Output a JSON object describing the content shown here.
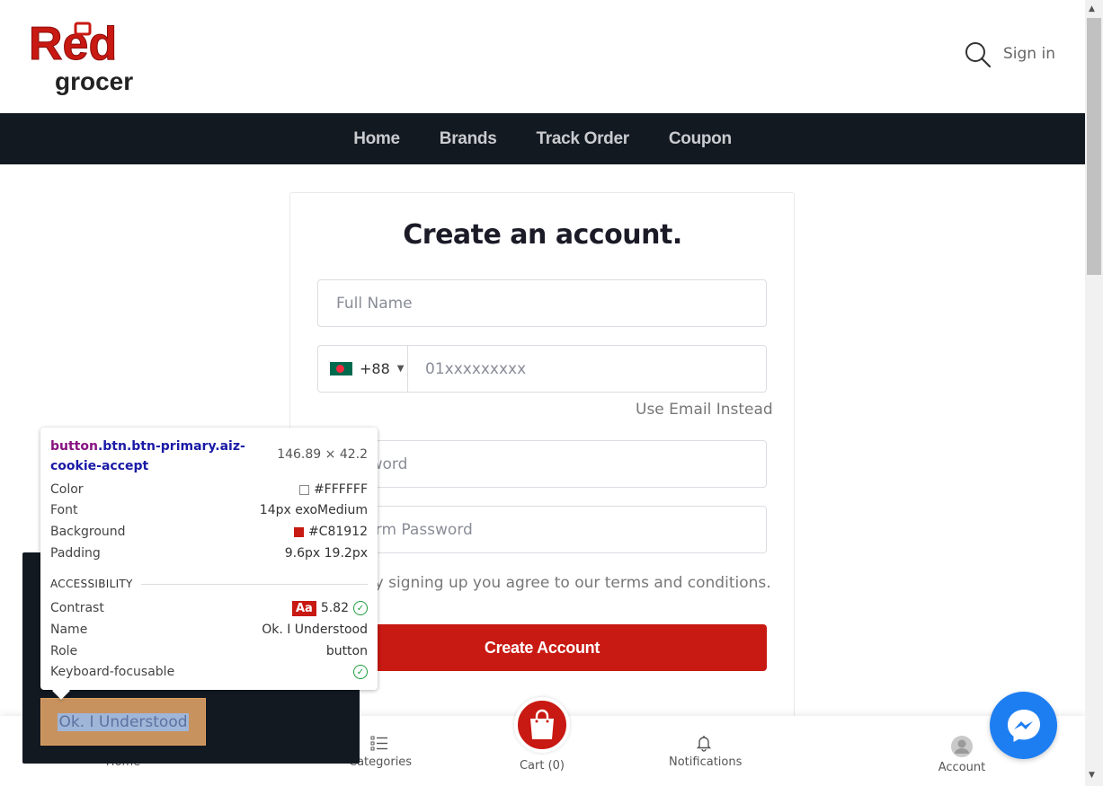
{
  "header": {
    "logo_top": "Red",
    "logo_bottom": "grocer",
    "signin_label": "Sign in"
  },
  "nav": {
    "items": [
      "Home",
      "Brands",
      "Track Order",
      "Coupon"
    ]
  },
  "form": {
    "title": "Create an account.",
    "full_name_placeholder": "Full Name",
    "country_code": "+88",
    "phone_placeholder": "01xxxxxxxxx",
    "use_email_label": "Use Email Instead",
    "password_placeholder": "Password",
    "confirm_password_placeholder": "Confirm Password",
    "terms_text": "By signing up you agree to our terms and conditions.",
    "submit_label": "Create Account"
  },
  "bottom_bar": {
    "home_label": "Home",
    "categories_label": "Categories",
    "cart_label": "Cart (0)",
    "notifications_label": "Notifications",
    "account_label": "Account"
  },
  "cookie": {
    "accept_label": "Ok. I Understood"
  },
  "devtools_tooltip": {
    "selector_tag": "button",
    "selector_classes": ".btn.btn-primary.aiz-cookie-accept",
    "dimensions": "146.89 × 42.2",
    "rows": [
      {
        "key": "Color",
        "value": "#FFFFFF"
      },
      {
        "key": "Font",
        "value": "14px exoMedium"
      },
      {
        "key": "Background",
        "value": "#C81912"
      },
      {
        "key": "Padding",
        "value": "9.6px 19.2px"
      }
    ],
    "accessibility_heading": "ACCESSIBILITY",
    "contrast_label": "Contrast",
    "contrast_badge": "Aa",
    "contrast_value": "5.82",
    "name_label": "Name",
    "name_value": "Ok. I Understood",
    "role_label": "Role",
    "role_value": "button",
    "keyboard_label": "Keyboard-focusable"
  },
  "colors": {
    "brand_red": "#C81912",
    "nav_bg": "#131921",
    "messenger_blue": "#1D7EF2"
  },
  "icons": {
    "search": "search-icon",
    "cart": "shopping-bag-icon",
    "messenger": "messenger-icon"
  }
}
